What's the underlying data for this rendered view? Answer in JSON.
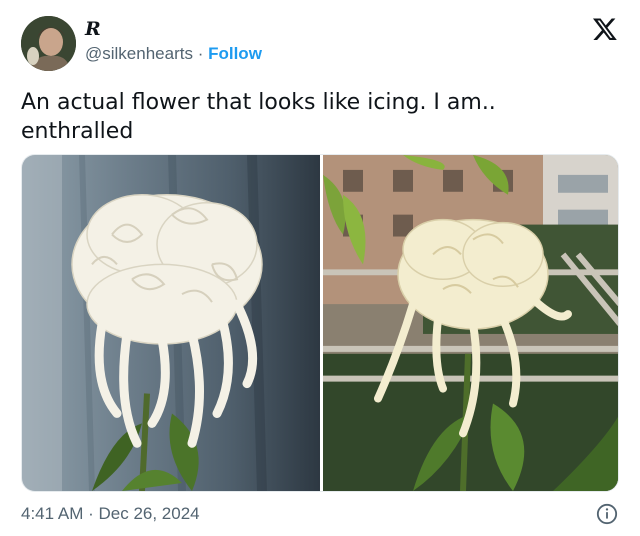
{
  "author": {
    "display_name": "R",
    "handle": "@silkenhearts",
    "separator": "·",
    "follow_label": "Follow",
    "avatar_icon": "avatar-photo"
  },
  "platform": {
    "logo_icon": "x-logo-icon"
  },
  "tweet": {
    "text": "An actual flower that looks like icing. I am.. enthralled"
  },
  "media": {
    "photos": [
      {
        "icon": "white-chrysanthemum-photo-indoor"
      },
      {
        "icon": "white-chrysanthemum-photo-balcony"
      }
    ]
  },
  "meta": {
    "time": "4:41 AM",
    "separator": "·",
    "date": "Dec 26, 2024",
    "info_icon": "info-icon"
  },
  "colors": {
    "accent": "#1d9bf0",
    "text": "#0f1419",
    "muted": "#536471"
  }
}
